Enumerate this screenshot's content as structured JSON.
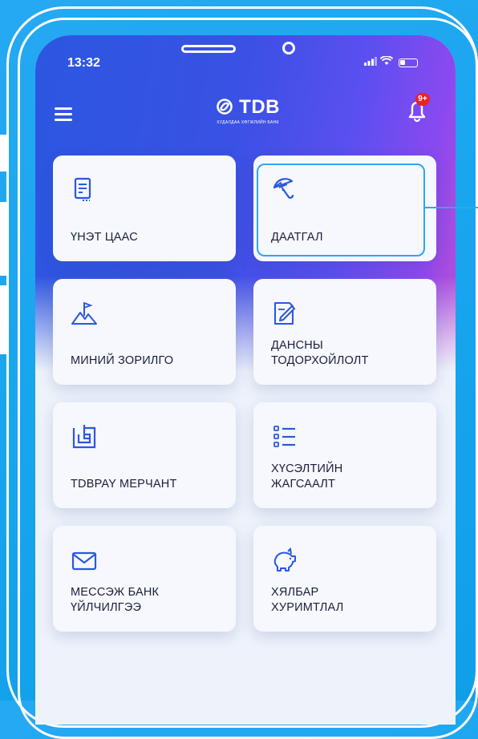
{
  "status_bar": {
    "time": "13:32"
  },
  "header": {
    "logo_text": "TDB",
    "logo_subtitle": "ХУДАЛДАА ХӨГЖЛИЙН БАНК",
    "notification_badge": "9+"
  },
  "menu": {
    "items": [
      {
        "label": "ҮНЭТ ЦААС",
        "icon": "document-icon"
      },
      {
        "label": "ДААТГАЛ",
        "icon": "umbrella-icon"
      },
      {
        "label": "МИНИЙ ЗОРИЛГО",
        "icon": "mountain-flag-icon"
      },
      {
        "label": "ДАНСНЫ\nТОДОРХОЙЛОЛТ",
        "icon": "edit-document-icon"
      },
      {
        "label": "TDBPAY МЕРЧАНТ",
        "icon": "merchant-icon"
      },
      {
        "label": "ХҮСЭЛТИЙН\nЖАГСААЛТ",
        "icon": "list-icon"
      },
      {
        "label": "МЕССЭЖ БАНК\nҮЙЛЧИЛГЭЭ",
        "icon": "envelope-icon"
      },
      {
        "label": "ХЯЛБАР\nХУРИМТЛАЛ",
        "icon": "piggy-bank-icon"
      }
    ]
  },
  "colors": {
    "accent": "#2ba8ee",
    "header_start": "#2b57e0",
    "header_end": "#c04ed2",
    "background": "#1aa6ef"
  }
}
